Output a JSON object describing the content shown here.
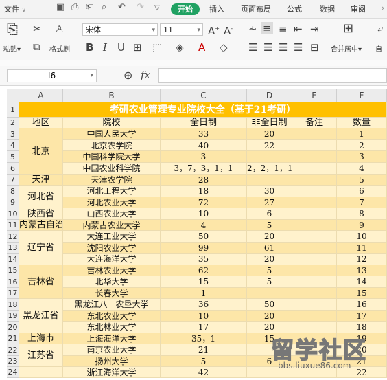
{
  "menu": {
    "file": "文件",
    "tabs": [
      "开始",
      "插入",
      "页面布局",
      "公式",
      "数据",
      "审阅"
    ]
  },
  "ribbon": {
    "paste_label": "粘贴",
    "format_brush_label": "格式刷",
    "font_name": "宋体",
    "font_size": "11",
    "merge_center_label": "合并居中",
    "auto_label": "自"
  },
  "formula_bar": {
    "cell_ref": "I6",
    "fx_label": "fx",
    "content": ""
  },
  "grid": {
    "columns": [
      "A",
      "B",
      "C",
      "D",
      "E",
      "F"
    ],
    "row_numbers": [
      "1",
      "2",
      "3",
      "4",
      "5",
      "6",
      "7",
      "8",
      "9",
      "10",
      "11",
      "12",
      "13",
      "14",
      "15",
      "16",
      "17",
      "18",
      "19",
      "20",
      "21",
      "22",
      "23",
      "24"
    ],
    "title": "考研农业管理专业院校大全（基于21考研）",
    "headers": [
      "地区",
      "院校",
      "全日制",
      "非全日制",
      "备注",
      "数量"
    ],
    "regions": [
      "北京",
      "天津",
      "河北省",
      "陕西省",
      "内蒙古自治区",
      "辽宁省",
      "吉林省",
      "黑龙江省",
      "上海市",
      "江苏省"
    ],
    "rows": [
      [
        "中国人民大学",
        "33",
        "20",
        "",
        "1"
      ],
      [
        "北京农学院",
        "40",
        "22",
        "",
        "2"
      ],
      [
        "中国科学院大学",
        "3",
        "",
        "",
        "3"
      ],
      [
        "中国农业科学院",
        "3，7，3，1，1",
        "2，2，1，1",
        "",
        "4"
      ],
      [
        "天津农学院",
        "28",
        "",
        "",
        "5"
      ],
      [
        "河北工程大学",
        "18",
        "30",
        "",
        "6"
      ],
      [
        "河北农业大学",
        "72",
        "27",
        "",
        "7"
      ],
      [
        "山西农业大学",
        "10",
        "6",
        "",
        "8"
      ],
      [
        "内蒙古农业大学",
        "4",
        "5",
        "",
        "9"
      ],
      [
        "大连工业大学",
        "50",
        "20",
        "",
        "10"
      ],
      [
        "沈阳农业大学",
        "99",
        "61",
        "",
        "11"
      ],
      [
        "大连海洋大学",
        "35",
        "20",
        "",
        "12"
      ],
      [
        "吉林农业大学",
        "62",
        "5",
        "",
        "13"
      ],
      [
        "北华大学",
        "15",
        "5",
        "",
        "14"
      ],
      [
        "长春大学",
        "1",
        "",
        "",
        "15"
      ],
      [
        "黑龙江八一农垦大学",
        "36",
        "50",
        "",
        "16"
      ],
      [
        "东北农业大学",
        "10",
        "20",
        "",
        "17"
      ],
      [
        "东北林业大学",
        "17",
        "20",
        "",
        "18"
      ],
      [
        "上海海洋大学",
        "35，1",
        "15",
        "",
        "19"
      ],
      [
        "南京农业大学",
        "21",
        "",
        "",
        "20"
      ],
      [
        "扬州大学",
        "5",
        "6",
        "",
        "21"
      ],
      [
        "浙江海洋大学",
        "42",
        "",
        "",
        "22"
      ]
    ]
  },
  "watermark": {
    "text": "留学社区",
    "url": "bbs.liuxue86.com"
  },
  "colors": {
    "title_fill": "#ffc000",
    "odd_fill": "#fff2cc",
    "even_fill": "#fde6a8",
    "start_tab": "#20a162"
  }
}
